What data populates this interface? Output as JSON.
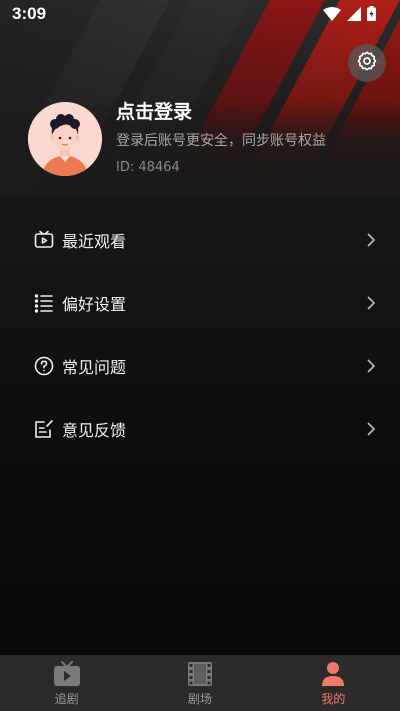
{
  "status_bar": {
    "time": "3:09"
  },
  "profile": {
    "title": "点击登录",
    "subtitle": "登录后账号更安全，同步账号权益",
    "id_text": "ID: 48464"
  },
  "menu": {
    "items": [
      {
        "label": "最近观看",
        "icon": "tv-icon"
      },
      {
        "label": "偏好设置",
        "icon": "list-icon"
      },
      {
        "label": "常见问题",
        "icon": "question-icon"
      },
      {
        "label": "意见反馈",
        "icon": "edit-icon"
      }
    ]
  },
  "bottom_nav": {
    "items": [
      {
        "label": "追剧",
        "icon": "tv-play-icon",
        "active": false
      },
      {
        "label": "剧场",
        "icon": "film-icon",
        "active": false
      },
      {
        "label": "我的",
        "icon": "person-icon",
        "active": true
      }
    ]
  },
  "colors": {
    "accent": "#ef7a6a",
    "inactive": "#9a9a9a",
    "nav_background": "#2c2a2a"
  }
}
